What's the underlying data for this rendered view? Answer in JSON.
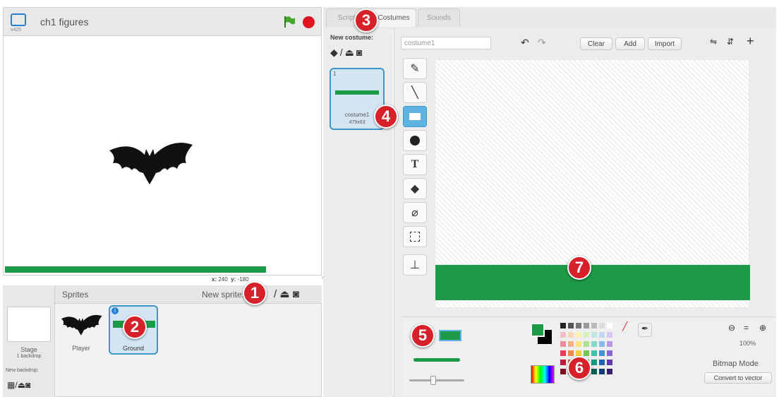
{
  "stage": {
    "title": "ch1 figures",
    "version_label": "v425",
    "coords": {
      "x_label": "x:",
      "x_value": "240",
      "y_label": "y:",
      "y_value": "-180"
    }
  },
  "sprites": {
    "header": "Sprites",
    "new_sprite_label": "New sprite:",
    "stage_label": "Stage",
    "stage_backdrops": "1 backdrop",
    "new_backdrop_label": "New backdrop:",
    "items": [
      {
        "name": "Player"
      },
      {
        "name": "Ground"
      }
    ]
  },
  "tabs": [
    {
      "label": "Scripts"
    },
    {
      "label": "Costumes"
    },
    {
      "label": "Sounds"
    }
  ],
  "costumes": {
    "new_costume_label": "New costume:",
    "items": [
      {
        "index": "1",
        "name": "costume1",
        "size": "479x63"
      }
    ]
  },
  "editor": {
    "costume_name": "costume1",
    "clear_label": "Clear",
    "add_label": "Add",
    "import_label": "Import",
    "zoom_level": "100%",
    "mode_label": "Bitmap Mode",
    "convert_label": "Convert to vector"
  },
  "tools": [
    {
      "name": "brush-tool-icon"
    },
    {
      "name": "line-tool-icon"
    },
    {
      "name": "rectangle-tool-icon"
    },
    {
      "name": "ellipse-tool-icon"
    },
    {
      "name": "text-tool-icon",
      "glyph": "T"
    },
    {
      "name": "fill-tool-icon"
    },
    {
      "name": "eraser-tool-icon"
    },
    {
      "name": "select-tool-icon"
    },
    {
      "name": "stamp-tool-icon"
    }
  ],
  "markers": [
    "1",
    "2",
    "3",
    "4",
    "5",
    "6",
    "7"
  ],
  "colors": {
    "green": "#1c9a45",
    "primary_swatch": "#1c9a45",
    "secondary_swatch": "#000000",
    "marker": "#d6202a",
    "selected_tool": "#5fb3e0"
  },
  "palette": [
    [
      "#222222",
      "#555555",
      "#777777",
      "#999999",
      "#bbbbbb",
      "#dddddd",
      "#ffffff"
    ],
    [
      "#f4c0c8",
      "#f8d8b8",
      "#fbf0b8",
      "#d8f0c0",
      "#c0e8e0",
      "#c0d8f0",
      "#d8c8f0"
    ],
    [
      "#ec8c9c",
      "#f4b484",
      "#f8e484",
      "#b0e08c",
      "#88d8c8",
      "#88b8e8",
      "#b898e0"
    ],
    [
      "#e0405c",
      "#ec8848",
      "#f0d040",
      "#70c850",
      "#40c0a8",
      "#4890d8",
      "#8868d0"
    ],
    [
      "#c01838",
      "#d86020",
      "#d8b018",
      "#38a030",
      "#109880",
      "#1c60b8",
      "#6038b0"
    ],
    [
      "#800c20",
      "#904010",
      "#907010",
      "#206818",
      "#086050",
      "#103c78",
      "#3c2070"
    ]
  ]
}
